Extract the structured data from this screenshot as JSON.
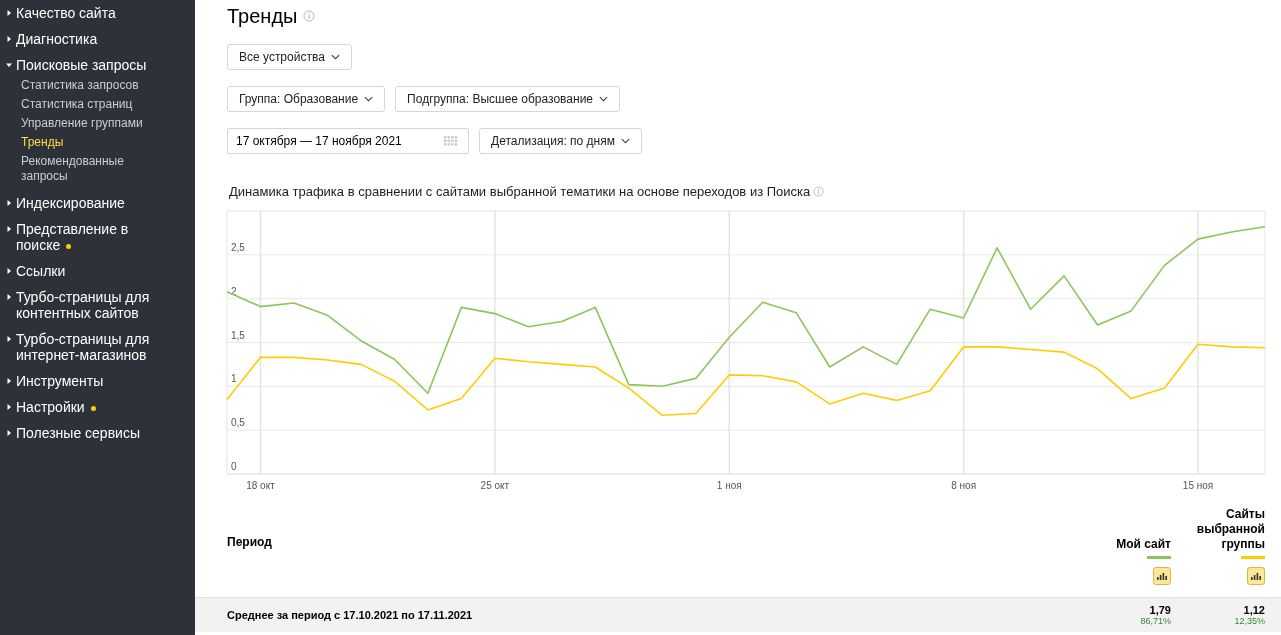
{
  "sidebar": {
    "items": [
      {
        "label": "Качество сайта",
        "expanded": false,
        "dot": false
      },
      {
        "label": "Диагностика",
        "expanded": false,
        "dot": false
      },
      {
        "label": "Поисковые запросы",
        "expanded": true,
        "dot": false,
        "children": [
          {
            "label": "Статистика запросов",
            "selected": false
          },
          {
            "label": "Статистика страниц",
            "selected": false
          },
          {
            "label": "Управление группами",
            "selected": false
          },
          {
            "label": "Тренды",
            "selected": true
          },
          {
            "label": "Рекомендованные запросы",
            "selected": false
          }
        ]
      },
      {
        "label": "Индексирование",
        "expanded": false,
        "dot": false
      },
      {
        "label": "Представление в поиске",
        "expanded": false,
        "dot": true
      },
      {
        "label": "Ссылки",
        "expanded": false,
        "dot": false
      },
      {
        "label": "Турбо-страницы для контентных сайтов",
        "expanded": false,
        "dot": false
      },
      {
        "label": "Турбо-страницы для интернет-магазинов",
        "expanded": false,
        "dot": false
      },
      {
        "label": "Инструменты",
        "expanded": false,
        "dot": false
      },
      {
        "label": "Настройки",
        "expanded": false,
        "dot": true
      },
      {
        "label": "Полезные сервисы",
        "expanded": false,
        "dot": false
      }
    ]
  },
  "page": {
    "title": "Тренды"
  },
  "filters": {
    "device": "Все устройства",
    "group": "Группа: Образование",
    "subgroup": "Подгруппа: Высшее образование",
    "date_range": "17 октября — 17 ноября 2021",
    "detail": "Детализация: по дням"
  },
  "chart": {
    "title": "Динамика трафика в сравнении с сайтами выбранной тематики на основе переходов из Поиска",
    "chart_data": {
      "type": "line",
      "categories": [
        null,
        "18 окт",
        null,
        null,
        null,
        null,
        null,
        null,
        "25 окт",
        null,
        null,
        null,
        null,
        null,
        null,
        "1 ноя",
        null,
        null,
        null,
        null,
        null,
        null,
        "8 ноя",
        null,
        null,
        null,
        null,
        null,
        null,
        "15 ноя",
        null,
        null
      ],
      "ylim": [
        0,
        3
      ],
      "grid": true,
      "yticks": [
        {
          "value": 0,
          "label": "0"
        },
        {
          "value": 0.5,
          "label": "0,5"
        },
        {
          "value": 1,
          "label": "1"
        },
        {
          "value": 1.5,
          "label": "1,5"
        },
        {
          "value": 2,
          "label": "2"
        },
        {
          "value": 2.5,
          "label": "2,5"
        }
      ],
      "series": [
        {
          "name": "Мой сайт",
          "color": "#8cc65a",
          "values": [
            2.08,
            1.91,
            1.95,
            1.81,
            1.52,
            1.31,
            0.92,
            1.9,
            1.83,
            1.68,
            1.74,
            1.9,
            1.02,
            1.0,
            1.09,
            1.56,
            1.96,
            1.84,
            1.22,
            1.45,
            1.25,
            1.88,
            1.78,
            2.58,
            1.88,
            2.26,
            1.7,
            1.86,
            2.38,
            2.68,
            2.76,
            2.82
          ]
        },
        {
          "name": "Сайты выбранной группы",
          "color": "#ffcc00",
          "values": [
            0.85,
            1.33,
            1.33,
            1.3,
            1.25,
            1.06,
            0.73,
            0.86,
            1.32,
            1.28,
            1.25,
            1.22,
            0.98,
            0.67,
            0.69,
            1.13,
            1.12,
            1.05,
            0.8,
            0.92,
            0.84,
            0.95,
            1.45,
            1.45,
            1.42,
            1.39,
            1.2,
            0.86,
            0.98,
            1.48,
            1.45,
            1.44
          ]
        }
      ]
    }
  },
  "table": {
    "period_header": "Период",
    "rows": [
      {
        "label": "Среднее за период с 17.10.2021 по 17.11.2021",
        "cells": [
          {
            "value": "1,79",
            "share": "86,71%"
          },
          {
            "value": "1,12",
            "share": "12,35%"
          }
        ]
      }
    ]
  }
}
